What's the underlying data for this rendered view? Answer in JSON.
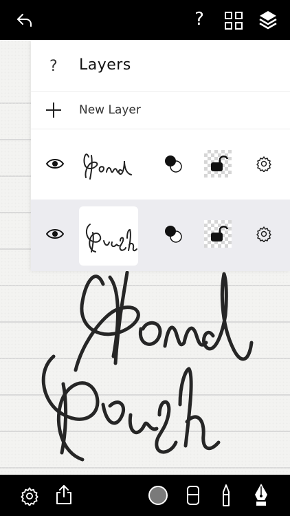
{
  "topbar": {
    "help_glyph": "?",
    "icons": [
      "undo-icon",
      "help-icon",
      "grid-icon",
      "layers-icon"
    ]
  },
  "layers_panel": {
    "help_glyph": "?",
    "title": "Layers",
    "new_layer_label": "New Layer",
    "layers": [
      {
        "name": "Ronnd",
        "selected": false
      },
      {
        "name": "Brush",
        "selected": true
      }
    ]
  },
  "bottombar": {
    "current_color": "#7a7a7a",
    "icons": [
      "settings-icon",
      "share-icon",
      "color-swatch",
      "eraser-icon",
      "brush-pen-icon",
      "nib-pen-icon"
    ]
  },
  "colors": {
    "bar": "#000000",
    "ink": "#222222",
    "selected_row": "#ececf0"
  }
}
